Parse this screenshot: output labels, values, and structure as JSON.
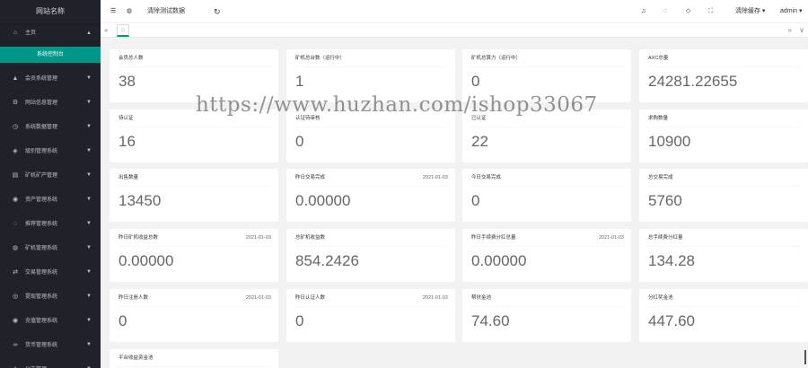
{
  "site_name": "网站名称",
  "sidebar": {
    "home": "主页",
    "sub_active": "系统控制台",
    "items": [
      {
        "icon": "▲",
        "label": "会员系统管理"
      },
      {
        "icon": "⚙",
        "label": "网站信息管理"
      },
      {
        "icon": "◷",
        "label": "系统数据管理"
      },
      {
        "icon": "◈",
        "label": "级别管理系统"
      },
      {
        "icon": "▤",
        "label": "矿机矿产管理"
      },
      {
        "icon": "◉",
        "label": "资产管理系统"
      },
      {
        "icon": "◌",
        "label": "推荐管理系统"
      },
      {
        "icon": "◍",
        "label": "矿机管理系统"
      },
      {
        "icon": "⇄",
        "label": "交易管理系统"
      },
      {
        "icon": "◎",
        "label": "提现管理系统"
      },
      {
        "icon": "◉",
        "label": "充值管理系统"
      },
      {
        "icon": "∞",
        "label": "货币管理系统"
      },
      {
        "icon": "◇",
        "label": "公告管理"
      }
    ]
  },
  "header": {
    "menu_icon": "☰",
    "globe_icon": "◍",
    "clear_test": "清除测试数据",
    "refresh_icon": "↻",
    "bell_icon": "♫",
    "chat_icon": "◌",
    "tag_icon": "◇",
    "fullscreen_icon": "⛶",
    "clear_cache": "清除缓存 ▾",
    "user": "admin ▾"
  },
  "tabs": {
    "prev": "«",
    "home_icon": "⌂",
    "next": "»",
    "down": "∨"
  },
  "cards": [
    {
      "label": "会员总人数",
      "value": "38",
      "date": ""
    },
    {
      "label": "矿机总台数（运行中）",
      "value": "1",
      "date": ""
    },
    {
      "label": "矿机总算力（运行中）",
      "value": "0",
      "date": ""
    },
    {
      "label": "AXC总量",
      "value": "24281.22655",
      "date": ""
    },
    {
      "label": "待认证",
      "value": "16",
      "date": ""
    },
    {
      "label": "认证待审核",
      "value": "0",
      "date": ""
    },
    {
      "label": "已认证",
      "value": "22",
      "date": ""
    },
    {
      "label": "求购数量",
      "value": "10900",
      "date": ""
    },
    {
      "label": "出售数量",
      "value": "13450",
      "date": ""
    },
    {
      "label": "昨日交易完成",
      "value": "0.00000",
      "date": "2021-01-03"
    },
    {
      "label": "今日交易完成",
      "value": "0",
      "date": ""
    },
    {
      "label": "总交易完成",
      "value": "5760",
      "date": ""
    },
    {
      "label": "昨日矿机收益总数",
      "value": "0.00000",
      "date": "2021-01-03"
    },
    {
      "label": "总矿机收益数",
      "value": "854.2426",
      "date": ""
    },
    {
      "label": "昨日手续费分红总量",
      "value": "0.00000",
      "date": "2021-01-03"
    },
    {
      "label": "总手续费分红量",
      "value": "134.28",
      "date": ""
    },
    {
      "label": "昨日注册人数",
      "value": "0",
      "date": "2021-01-03"
    },
    {
      "label": "昨日认证人数",
      "value": "0",
      "date": "2021-01-03"
    },
    {
      "label": "帮扶金池",
      "value": "74.60",
      "date": ""
    },
    {
      "label": "分红奖金池",
      "value": "447.60",
      "date": ""
    },
    {
      "label": "平台收益资金池",
      "value": "",
      "date": ""
    }
  ],
  "watermark": "https://www.huzhan.com/ishop33067"
}
